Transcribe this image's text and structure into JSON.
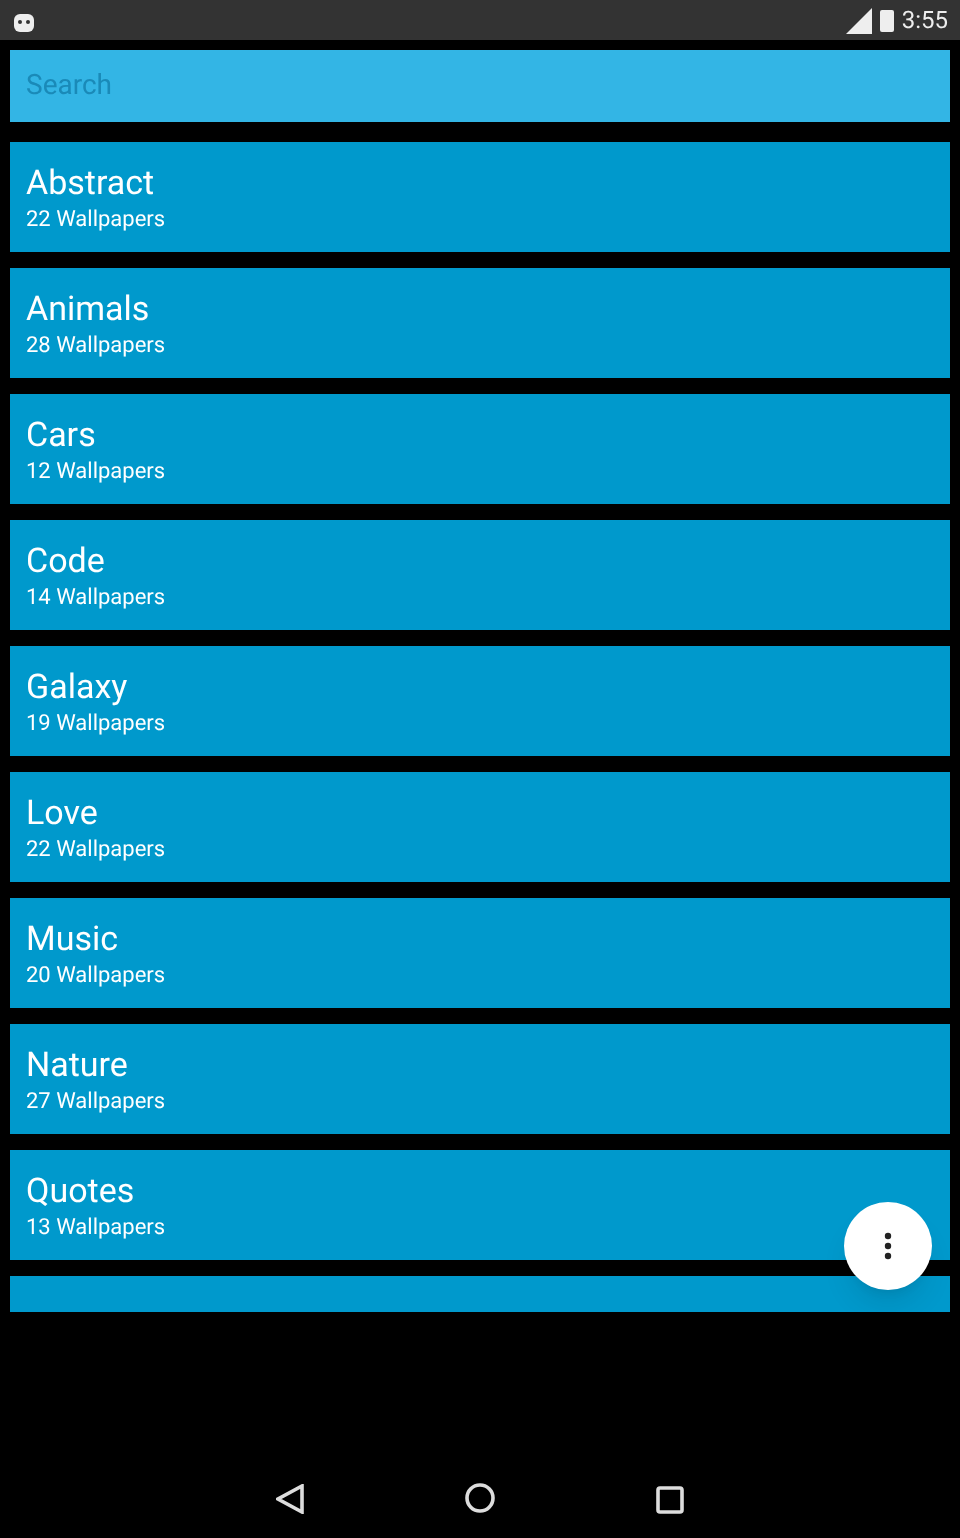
{
  "status_bar": {
    "time": "3:55"
  },
  "search": {
    "placeholder": "Search"
  },
  "categories": [
    {
      "name": "Abstract",
      "count": "22 Wallpapers"
    },
    {
      "name": "Animals",
      "count": "28 Wallpapers"
    },
    {
      "name": "Cars",
      "count": "12 Wallpapers"
    },
    {
      "name": "Code",
      "count": "14 Wallpapers"
    },
    {
      "name": "Galaxy",
      "count": "19 Wallpapers"
    },
    {
      "name": "Love",
      "count": "22 Wallpapers"
    },
    {
      "name": "Music",
      "count": "20 Wallpapers"
    },
    {
      "name": "Nature",
      "count": "27 Wallpapers"
    },
    {
      "name": "Quotes",
      "count": "13 Wallpapers"
    }
  ]
}
